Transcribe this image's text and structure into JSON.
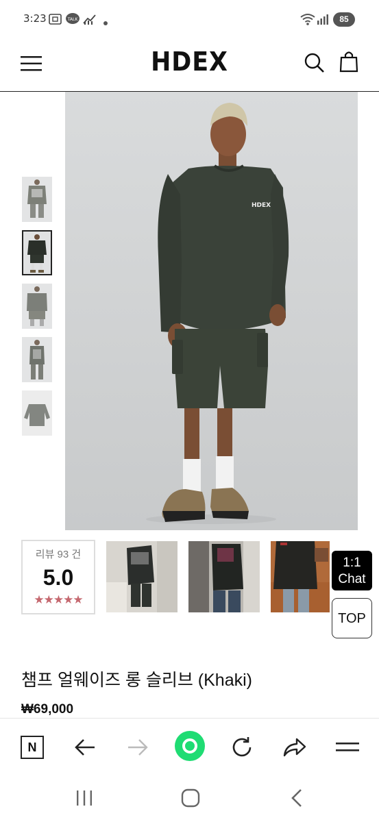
{
  "status_bar": {
    "time": "3:23",
    "battery": "85"
  },
  "header": {
    "logo": "HDEX"
  },
  "product_image": {
    "chest_logo": "HDEX"
  },
  "review": {
    "count_label": "리뷰 93 건",
    "score": "5.0",
    "stars": "★★★★★"
  },
  "floating": {
    "chat_line1": "1:1",
    "chat_line2": "Chat",
    "top_label": "TOP"
  },
  "product": {
    "title": "챔프 얼웨이즈 롱 슬리브 (Khaki)",
    "price": "₩69,000"
  },
  "browser_bar": {
    "n_label": "N"
  },
  "colors": {
    "accent_green": "#1fdc73",
    "star_color": "#c5686f",
    "shirt_khaki": "#3a4239"
  }
}
